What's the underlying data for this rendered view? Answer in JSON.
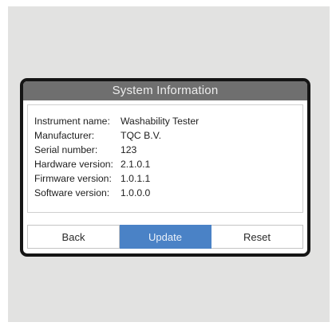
{
  "dialog": {
    "title": "System Information"
  },
  "info": [
    {
      "label": "Instrument name:",
      "value": "Washability Tester"
    },
    {
      "label": "Manufacturer:",
      "value": "TQC B.V."
    },
    {
      "label": "Serial number:",
      "value": "123"
    },
    {
      "label": "Hardware version:",
      "value": "2.1.0.1"
    },
    {
      "label": "Firmware version:",
      "value": "1.0.1.1"
    },
    {
      "label": "Software version:",
      "value": "1.0.0.0"
    }
  ],
  "buttons": {
    "back": "Back",
    "update": "Update",
    "reset": "Reset"
  },
  "colors": {
    "title_bar": "#6f6f6f",
    "primary_button": "#4a82c6",
    "bezel": "#151515"
  }
}
